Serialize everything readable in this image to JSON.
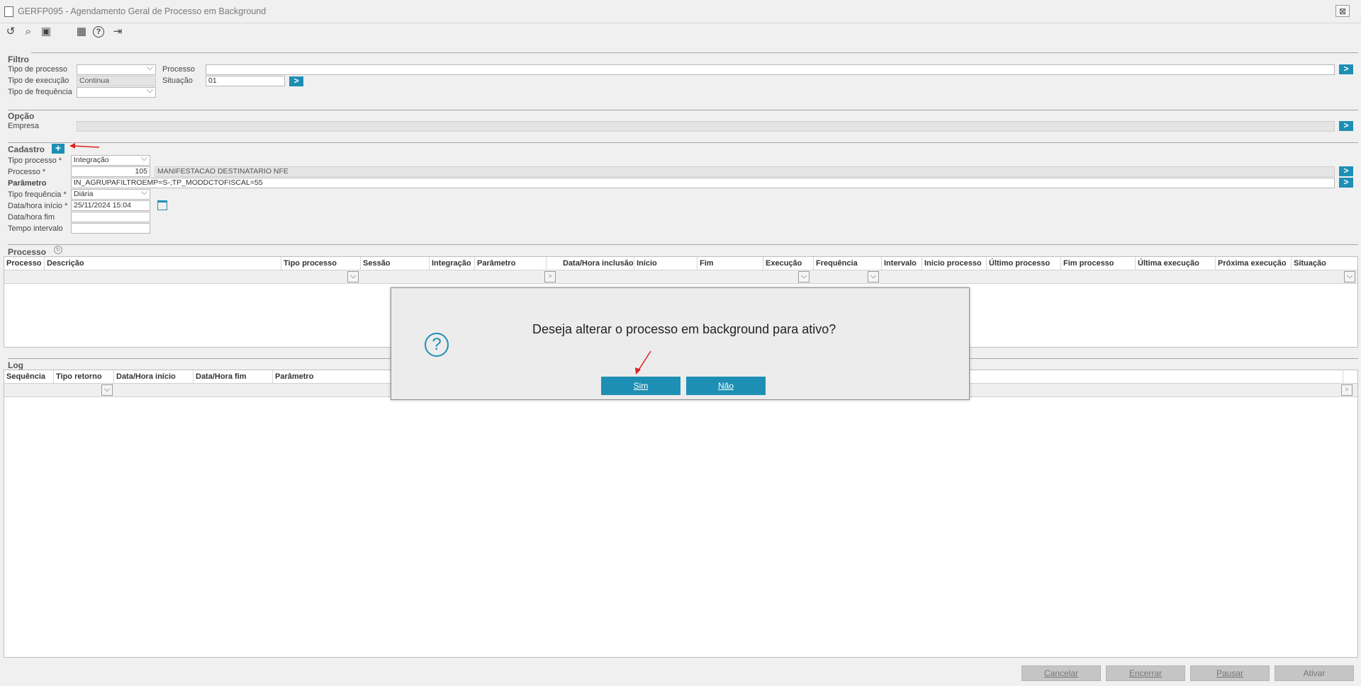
{
  "window": {
    "title": "GERFP095 - Agendamento Geral de Processo em Background",
    "close": "⊠"
  },
  "toolbar": {
    "icons": [
      "refresh-icon",
      "search-icon",
      "save-icon",
      "calendar-icon",
      "help-icon",
      "exit-icon"
    ],
    "glyphs": {
      "refresh": "↺",
      "search": "⌕",
      "save": "▣",
      "calendar": "▦",
      "help": "?",
      "exit": "⇥"
    }
  },
  "filtro": {
    "title": "Filtro",
    "tipo_processo_label": "Tipo de processo",
    "tipo_execucao_label": "Tipo de execução",
    "tipo_execucao_value": "Continua",
    "tipo_frequencia_label": "Tipo de frequência",
    "processo_label": "Processo",
    "situacao_label": "Situação",
    "situacao_value": "01"
  },
  "opcao": {
    "title": "Opção",
    "empresa_label": "Empresa"
  },
  "cadastro": {
    "title": "Cadastro",
    "add": "+",
    "tipo_processo_label": "Tipo processo *",
    "tipo_processo_value": "Integração",
    "processo_label": "Processo *",
    "processo_code": "105",
    "processo_desc": "MANIFESTACAO DESTINATARIO NFE",
    "parametro_label": "Parâmetro",
    "parametro_value": "IN_AGRUPAFILTROEMP=S-;TP_MODDCTOFISCAL=55",
    "tipo_frequencia_label": "Tipo frequência *",
    "tipo_frequencia_value": "Diária",
    "data_inicio_label": "Data/hora início *",
    "data_inicio_value": "25/11/2024 15:04",
    "data_fim_label": "Data/hora fim",
    "tempo_intervalo_label": "Tempo intervalo"
  },
  "processo_grid": {
    "title": "Processo",
    "columns": [
      "Processo",
      "Descrição",
      "Tipo processo",
      "Sessão",
      "Integração",
      "Parâmetro",
      "Data/Hora inclusão",
      "Início",
      "Fim",
      "Execução",
      "Frequência",
      "Intervalo",
      "Início processo",
      "Último processo",
      "Fim processo",
      "Última execução",
      "Próxima execução",
      "Situação"
    ]
  },
  "log_grid": {
    "title": "Log",
    "columns": [
      "Sequência",
      "Tipo retorno",
      "Data/Hora início",
      "Data/Hora fim",
      "Parâmetro"
    ]
  },
  "footer": {
    "cancelar": "Cancelar",
    "encerrar": "Encerrar",
    "pausar": "Pausar",
    "ativar": "Ativar"
  },
  "dialog": {
    "message": "Deseja alterar o processo em background para ativo?",
    "icon": "?",
    "yes": "Sim",
    "no": "Não"
  },
  "colors": {
    "accent": "#1e8fb4",
    "annotation": "#e02020"
  }
}
